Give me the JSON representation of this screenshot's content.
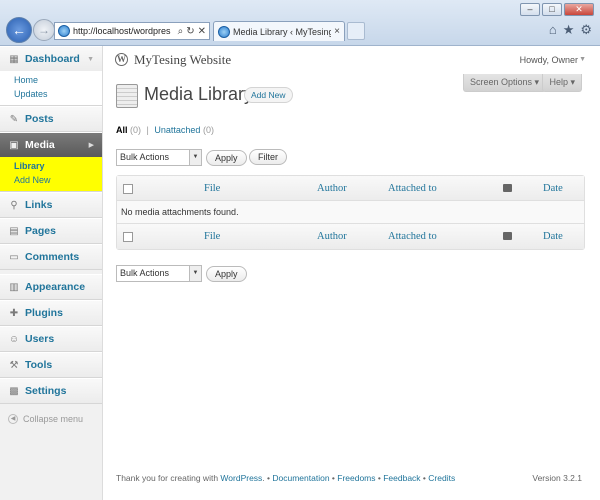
{
  "browser": {
    "address_url": "http://localhost/wordpres",
    "tab_title": "Media Library ‹ MyTesing ...",
    "tab_close": "×",
    "win_min": "–",
    "win_max": "□",
    "win_close": "✕",
    "back": "←",
    "forward": "→",
    "search_glyph": "⌕",
    "refresh_glyph": "↻",
    "stop_glyph": "✕",
    "home_glyph": "⌂",
    "fav_glyph": "★",
    "tools_glyph": "⚙"
  },
  "sidebar": {
    "dashboard": {
      "label": "Dashboard",
      "items": [
        "Home",
        "Updates"
      ]
    },
    "posts": "Posts",
    "media": {
      "label": "Media",
      "items": [
        "Library",
        "Add New"
      ]
    },
    "links": "Links",
    "pages": "Pages",
    "comments": "Comments",
    "appearance": "Appearance",
    "plugins": "Plugins",
    "users": "Users",
    "tools": "Tools",
    "settings": "Settings",
    "collapse": "Collapse menu"
  },
  "header": {
    "site_name": "MyTesing Website",
    "howdy": "Howdy, Owner",
    "screen_options": "Screen Options ▾",
    "help": "Help ▾"
  },
  "page": {
    "title": "Media Library",
    "add_new": "Add New",
    "filters": {
      "all": "All",
      "all_count": "(0)",
      "sep": "|",
      "unattached": "Unattached",
      "unattached_count": "(0)"
    },
    "bulk_actions": "Bulk Actions",
    "apply": "Apply",
    "filter": "Filter"
  },
  "table": {
    "columns": {
      "file": "File",
      "author": "Author",
      "attached": "Attached to",
      "date": "Date"
    },
    "empty_message": "No media attachments found."
  },
  "footer": {
    "thanks": "Thank you for creating with ",
    "wordpress": "WordPress",
    "dot": ". • ",
    "documentation": "Documentation",
    "freedoms": "Freedoms",
    "feedback": "Feedback",
    "credits": "Credits",
    "bullet": " • ",
    "version": "Version 3.2.1"
  }
}
